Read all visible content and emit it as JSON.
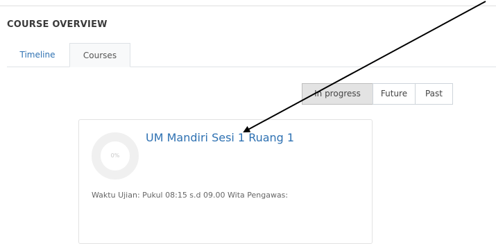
{
  "section": {
    "title": "COURSE OVERVIEW"
  },
  "tabs": [
    {
      "label": "Timeline",
      "active": false
    },
    {
      "label": "Courses",
      "active": true
    }
  ],
  "filters": [
    {
      "label": "In progress",
      "selected": true
    },
    {
      "label": "Future",
      "selected": false
    },
    {
      "label": "Past",
      "selected": false
    }
  ],
  "course_card": {
    "title": "UM Mandiri Sesi 1 Ruang 1",
    "progress": "0%",
    "summary": "Waktu Ujian: Pukul 08:15 s.d 09.00 Wita Pengawas:"
  },
  "colors": {
    "link": "#2e71b2",
    "selected_filter_bg": "#e3e3e3",
    "annotation_arrow": "#000000"
  }
}
